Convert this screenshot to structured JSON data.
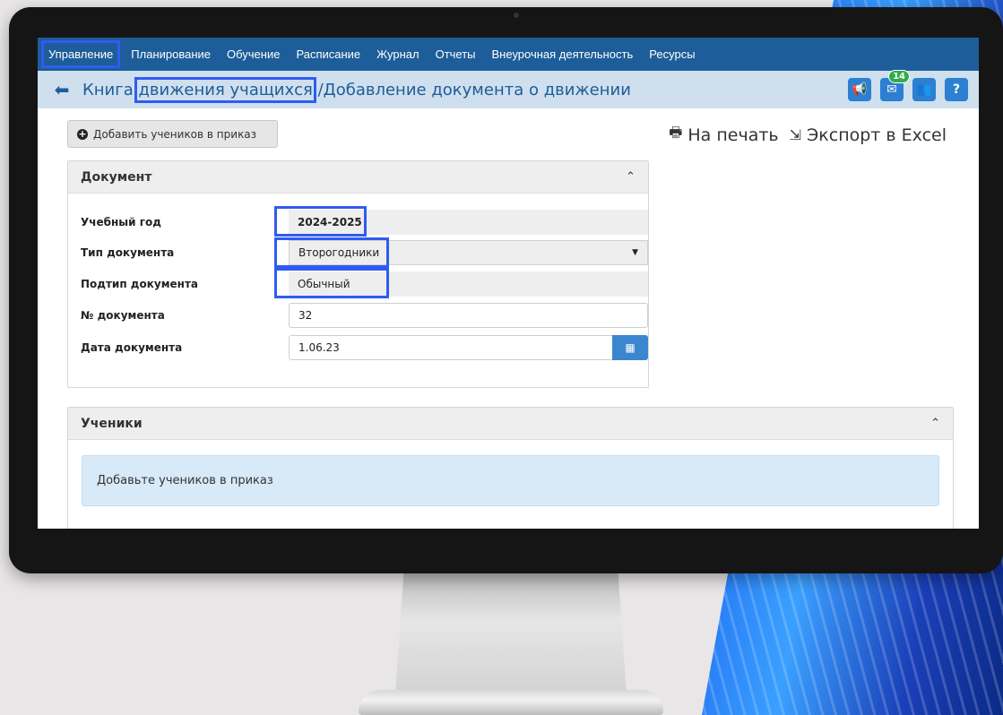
{
  "menu": {
    "items": [
      {
        "label": "Управление"
      },
      {
        "label": "Планирование"
      },
      {
        "label": "Обучение"
      },
      {
        "label": "Расписание"
      },
      {
        "label": "Журнал"
      },
      {
        "label": "Отчеты"
      },
      {
        "label": "Внеурочная деятельность"
      },
      {
        "label": "Ресурсы"
      }
    ],
    "active_index": 0
  },
  "header": {
    "title_part1": "Книга ",
    "title_part2": "движения учащихся",
    "title_part3": " /Добавление документа о движении",
    "icons": [
      "megaphone-icon",
      "mail-icon",
      "users-icon",
      "help-icon"
    ],
    "mail_badge": "14",
    "help_label": "?"
  },
  "toolbar": {
    "add_students_label": "Добавить учеников в приказ",
    "print_label": "На печать",
    "export_label": "Экспорт в Excel"
  },
  "document_panel": {
    "title": "Документ",
    "fields": {
      "year": {
        "label": "Учебный год",
        "value": "2024-2025"
      },
      "doc_type": {
        "label": "Тип документа",
        "value": "Второгодники"
      },
      "doc_subtype": {
        "label": "Подтип документа",
        "value": "Обычный"
      },
      "doc_number": {
        "label": "№ документа",
        "value": "32"
      },
      "doc_date": {
        "label": "Дата документа",
        "value": "1.06.23"
      }
    }
  },
  "students_panel": {
    "title": "Ученики",
    "empty_message": "Добавьте учеников в приказ"
  },
  "colors": {
    "menubar": "#1d5d99",
    "titlebar": "#cfdfee",
    "highlight": "#2f5cf0",
    "badge": "#2fae48"
  }
}
